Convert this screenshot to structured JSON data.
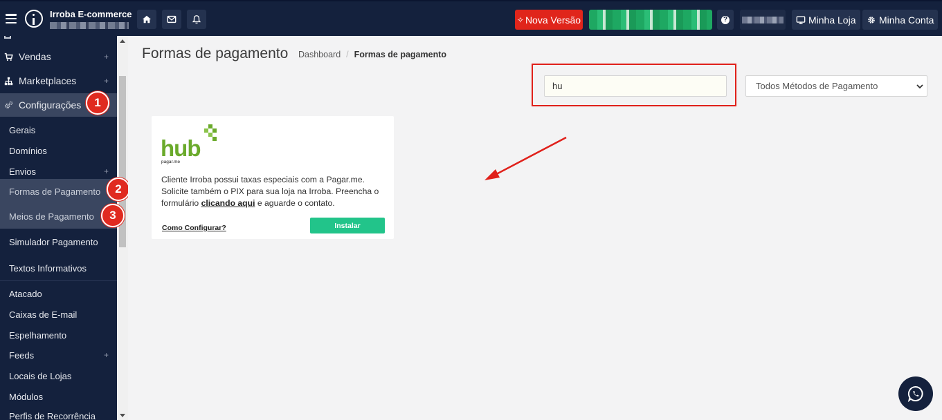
{
  "topbar": {
    "app_name": "Irroba E-commerce",
    "nova_versao": "Nova Versão",
    "help_glyph": "?",
    "minha_loja": "Minha Loja",
    "minha_conta": "Minha Conta",
    "accent_red": "#e0251b",
    "bg": "#14213d"
  },
  "sidebar": {
    "main": [
      {
        "label": "Vendas",
        "icon": "cart-icon",
        "expandable": "+"
      },
      {
        "label": "Marketplaces",
        "icon": "sitemap-icon",
        "expandable": "+"
      },
      {
        "label": "Configurações",
        "icon": "gears-icon",
        "expandable": ""
      }
    ],
    "sub": [
      {
        "label": "Gerais",
        "expandable": ""
      },
      {
        "label": "Domínios",
        "expandable": ""
      },
      {
        "label": "Envios",
        "expandable": "+"
      },
      {
        "label": "Formas de Pagamento",
        "expandable": ""
      },
      {
        "label": "Meios de Pagamento",
        "expandable": ""
      },
      {
        "label": "Simulador Pagamento",
        "expandable": ""
      },
      {
        "label": "Textos Informativos",
        "expandable": ""
      },
      {
        "label": "Atacado",
        "expandable": ""
      },
      {
        "label": "Caixas de E-mail",
        "expandable": ""
      },
      {
        "label": "Espelhamento",
        "expandable": ""
      },
      {
        "label": "Feeds",
        "expandable": "+"
      },
      {
        "label": "Locais de Lojas",
        "expandable": ""
      },
      {
        "label": "Módulos",
        "expandable": ""
      },
      {
        "label": "Perfis de Recorrência",
        "expandable": ""
      }
    ]
  },
  "steps": [
    "1",
    "2",
    "3"
  ],
  "main": {
    "title": "Formas de pagamento",
    "breadcrumb": {
      "home": "Dashboard",
      "sep": "/",
      "current": "Formas de pagamento"
    },
    "search": {
      "value": "hu"
    },
    "filter": {
      "selected": "Todos Métodos de Pagamento"
    },
    "card": {
      "logo_text": "hub",
      "logo_sub": "pagar.me",
      "desc_part1": "Cliente Irroba possui taxas especiais com a Pagar.me. Solicite também o PIX para sua loja na Irroba. Preencha o formulário ",
      "desc_link": "clicando aqui",
      "desc_part2": " e aguarde o contato.",
      "howto": "Como Configurar?",
      "install": "Instalar",
      "install_color": "#22c48a"
    }
  }
}
